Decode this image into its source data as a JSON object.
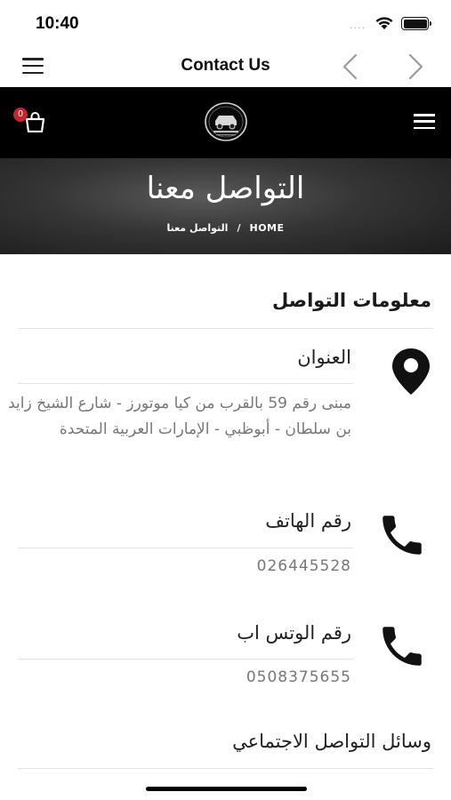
{
  "status_bar": {
    "time": "10:40",
    "signal": "....",
    "icons": [
      "wifi-icon",
      "battery-icon"
    ]
  },
  "nav": {
    "title": "Contact Us",
    "icons": [
      "menu-icon",
      "back-arrow-icon",
      "forward-arrow-icon"
    ]
  },
  "header": {
    "cart_count": "0",
    "icons": [
      "cart-icon",
      "logo",
      "hamburger-icon"
    ]
  },
  "hero": {
    "title": "التواصل معنا",
    "breadcrumb_home": "HOME",
    "breadcrumb_separator": "/",
    "breadcrumb_current": "التواصل معنا"
  },
  "contact": {
    "heading": "معلومات التواصل",
    "address_label": "العنوان",
    "address_value": "مبنى رقم 59 بالقرب من كيا موتورز - شارع الشيخ زايد بن سلطان - أبوظبي - الإمارات العربية المتحدة",
    "phone_label": "رقم الهاتف",
    "phone_value": "026445528",
    "whatsapp_label": "رقم الوتس اب",
    "whatsapp_value": "0508375655",
    "social_label": "وسائل التواصل الاجتماعي"
  },
  "colors": {
    "header_bg": "#000000",
    "badge": "#c0272d",
    "muted_text": "#777777"
  }
}
